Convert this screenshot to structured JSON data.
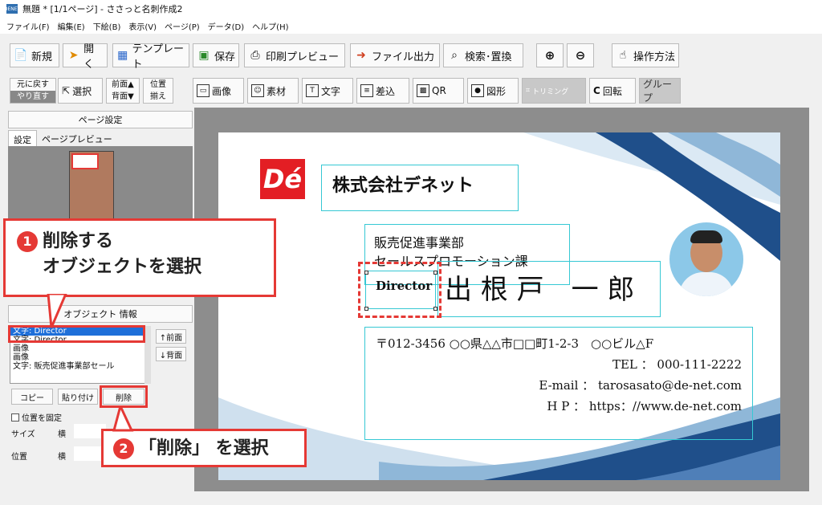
{
  "window": {
    "title": "無題 * [1/1ページ] - ささっと名刺作成2",
    "app_icon_label": "DENET"
  },
  "menu": [
    "ファイル(F)",
    "編集(E)",
    "下絵(B)",
    "表示(V)",
    "ページ(P)",
    "データ(D)",
    "ヘルプ(H)"
  ],
  "toolbar1": {
    "new": "新規",
    "open": "開く",
    "template": "テンプレート",
    "save": "保存",
    "print_preview": "印刷プレビュー",
    "file_output": "ファイル出力",
    "search_replace": "検索･置換",
    "zoom_in": "⊕",
    "zoom_out": "⊖",
    "help": "操作方法"
  },
  "toolbar2": {
    "undo": "元に戻す",
    "redo": "やり直す",
    "select": "選択",
    "front": "前面▲",
    "back": "背面▼",
    "position": "位置",
    "align": "揃え",
    "image": "画像",
    "material": "素材",
    "text": "文字",
    "merge": "差込",
    "qr": "QR",
    "shape": "図形",
    "trimming": "トリミング",
    "rotate": "回転",
    "group": "グループ"
  },
  "left_panel": {
    "page_settings": "ページ設定",
    "tab_settings": "設定",
    "tab_preview": "ページプレビュー",
    "object_info": "オブジェクト 情報",
    "objects": [
      "文字: Director",
      "文字: Director",
      "画像",
      "画像",
      "文字: 販売促進事業部セール"
    ],
    "front": "↑前面",
    "back": "↓背面",
    "copy": "コピー",
    "paste": "貼り付け",
    "delete": "削除",
    "lock_position": "位置を固定",
    "size_label": "サイズ",
    "horizontal": "横",
    "position_label": "位置",
    "horizontal2": "横"
  },
  "card": {
    "logo": "Dé",
    "company": "株式会社デネット",
    "department": "販売促進事業部",
    "section": "セールスプロモーション課",
    "title": "Director",
    "name": "出 根 戸　一 郎",
    "address": "〒012-3456 ○○県△△市□□町1-2-3　○○ビル△F",
    "tel": "TEL ： 000-111-2222",
    "email": "E-mail ： tarosasato@de-net.com",
    "hp": "H P ： https：//www.de-net.com"
  },
  "annotations": {
    "step1_num": "1",
    "step1_line1": "削除する",
    "step1_line2": "オブジェクトを選択",
    "step2_num": "2",
    "step2": "「削除」 を選択"
  },
  "colors": {
    "accent_red": "#e53935",
    "selection_blue": "#1e6fd9",
    "frame_cyan": "#36c8d4"
  }
}
